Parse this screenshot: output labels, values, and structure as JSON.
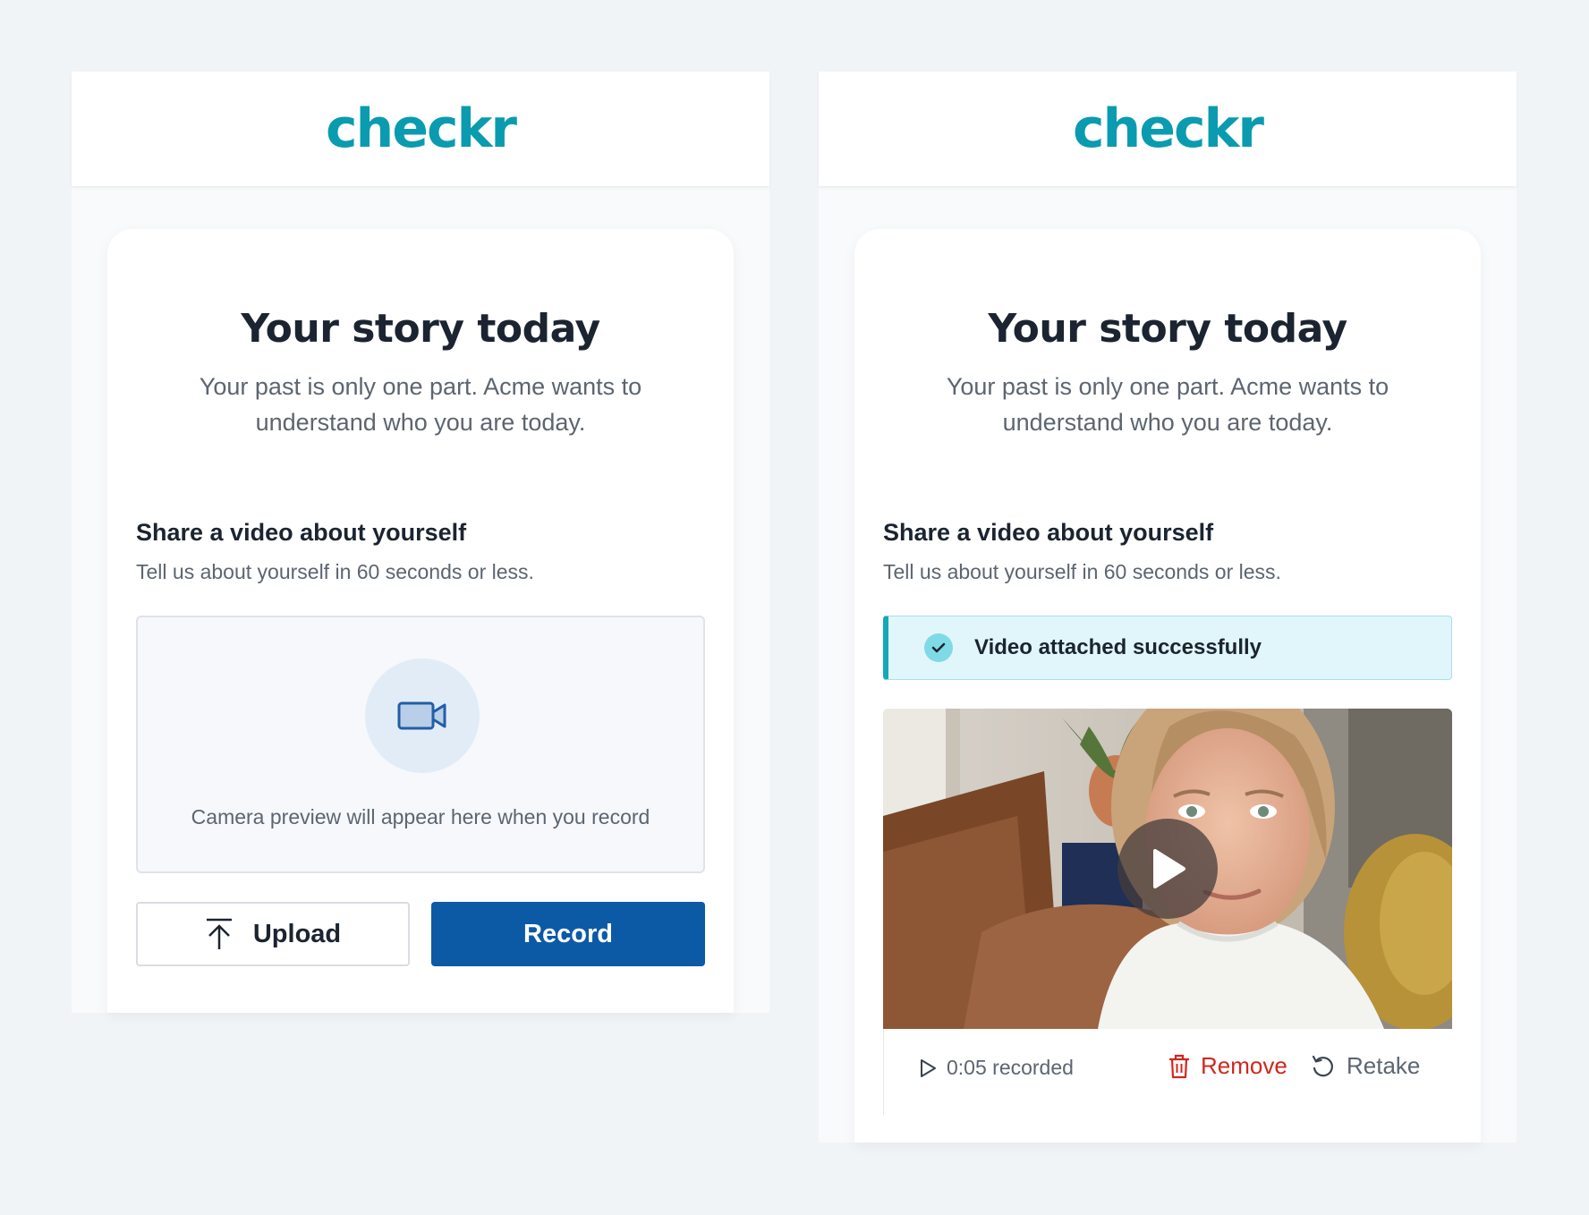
{
  "brand": {
    "logo_text": "checkr",
    "color": "#0b9bb0"
  },
  "left": {
    "title": "Your story today",
    "subtitle": "Your past is only one part. Acme wants to understand who you are today.",
    "section_heading": "Share a video about yourself",
    "section_subtext": "Tell us about yourself in 60 seconds or less.",
    "preview_icon": "video-camera-icon",
    "preview_text": "Camera preview will appear here when you record",
    "upload_label": "Upload",
    "upload_icon": "upload-arrow-icon",
    "record_label": "Record",
    "record_color": "#0c5aa6"
  },
  "right": {
    "title": "Your story today",
    "subtitle": "Your past is only one part. Acme wants to understand who you are today.",
    "section_heading": "Share a video about yourself",
    "section_subtext": "Tell us about yourself in 60 seconds or less.",
    "success_message": "Video attached successfully",
    "success_icon": "check-circle-icon",
    "video_play_icon": "play-icon",
    "recorded_text": "0:05 recorded",
    "remove_label": "Remove",
    "remove_icon": "trash-icon",
    "remove_color": "#d0271e",
    "retake_label": "Retake",
    "retake_icon": "retake-icon"
  }
}
